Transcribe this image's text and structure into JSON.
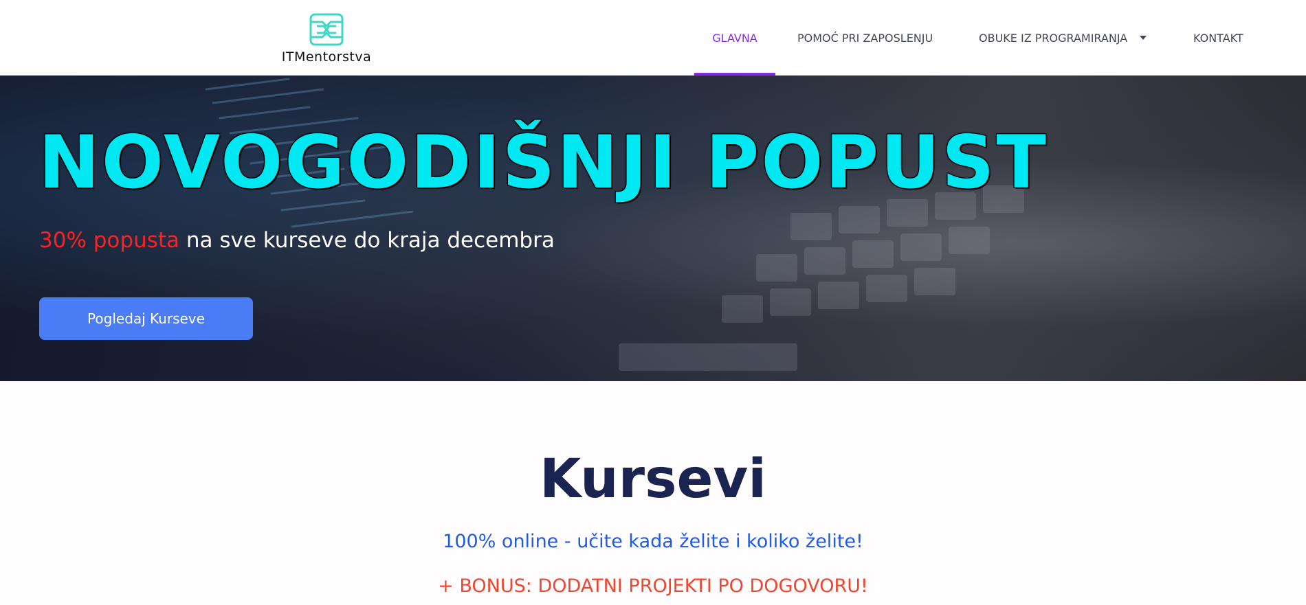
{
  "header": {
    "logo_text": "ITMentorstva",
    "logo_icon": "itm-logo-icon",
    "nav": [
      {
        "label": "GLAVNA",
        "active": true
      },
      {
        "label": "POMOĆ PRI ZAPOSLENJU",
        "active": false
      },
      {
        "label": "OBUKE IZ PROGRAMIRANJA",
        "active": false,
        "has_dropdown": true
      },
      {
        "label": "KONTAKT",
        "active": false
      }
    ]
  },
  "hero": {
    "title": "NOVOGODIŠNJI POPUST",
    "subtitle_highlight": "30% popusta",
    "subtitle_rest": " na sve kurseve do kraja decembra",
    "button_label": "Pogledaj Kurseve"
  },
  "courses": {
    "title": "Kursevi",
    "subtitle": "100% online - učite kada želite i koliko želite!",
    "bonus": "+ BONUS: DODATNI PROJEKTI PO DOGOVORU!"
  },
  "colors": {
    "accent": "#8a2be2",
    "hero_title": "#00e8f2",
    "highlight_red": "#ff2020",
    "button": "#4a7df5",
    "section_title": "#1b2450",
    "section_sub": "#1e5be6",
    "section_bonus": "#f0452f"
  }
}
